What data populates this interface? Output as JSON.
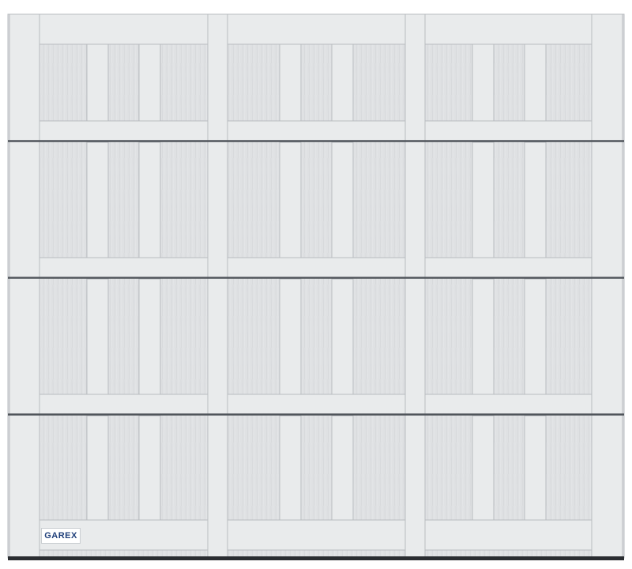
{
  "product": {
    "brand_logo_text": "GAREX"
  },
  "door": {
    "sections": 4,
    "columns": 3,
    "colors": {
      "panel": "#dfe1e3",
      "trim": "#e9ebec",
      "edge": "#b9bcc0",
      "shadow": "#a6aaaf",
      "seam": "#50555b",
      "bottom_seal": "#2a2d31"
    }
  }
}
